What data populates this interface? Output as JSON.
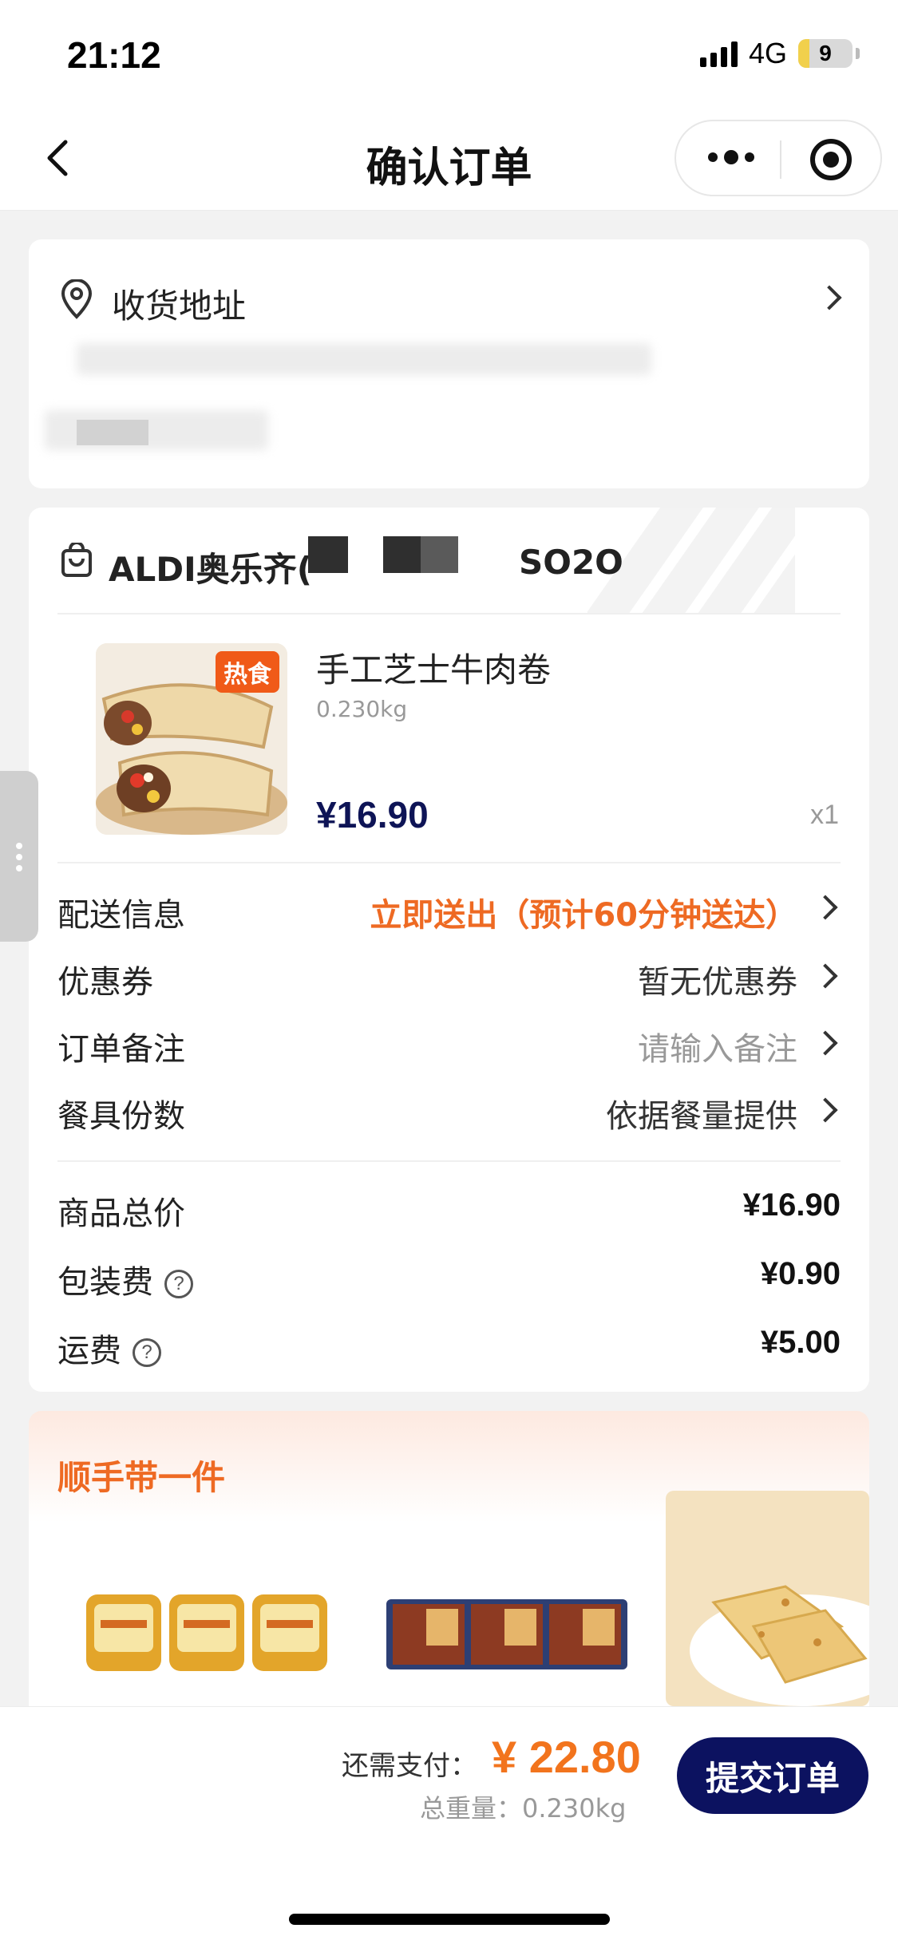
{
  "status_bar": {
    "time": "21:12",
    "network": "4G",
    "battery": "9"
  },
  "nav": {
    "title": "确认订单"
  },
  "address": {
    "title": "收货地址"
  },
  "store": {
    "name": "ALDI奥乐齐(",
    "suffix": "SO2O"
  },
  "product": {
    "name": "手工芝士牛肉卷",
    "weight": "0.230kg",
    "price": "¥16.90",
    "qty": "x1",
    "tag": "热食"
  },
  "rows": {
    "delivery": {
      "label": "配送信息",
      "value": "立即送出（预计60分钟送达）"
    },
    "coupon": {
      "label": "优惠券",
      "value": "暂无优惠券"
    },
    "note": {
      "label": "订单备注",
      "value": "请输入备注"
    },
    "tableware": {
      "label": "餐具份数",
      "value": "依据餐量提供"
    }
  },
  "pricing": {
    "goods_label": "商品总价",
    "goods_value": "¥16.90",
    "packaging_label": "包装费",
    "packaging_value": "¥0.90",
    "shipping_label": "运费",
    "shipping_value": "¥5.00",
    "help_symbol": "?"
  },
  "addon": {
    "title": "顺手带一件"
  },
  "footer": {
    "pay_label": "还需支付：",
    "pay_amount": "¥ 22.80",
    "weight": "总重量：0.230kg",
    "submit": "提交订单"
  },
  "colors": {
    "accent_orange": "#ee6a23",
    "navy": "#0c1260"
  }
}
